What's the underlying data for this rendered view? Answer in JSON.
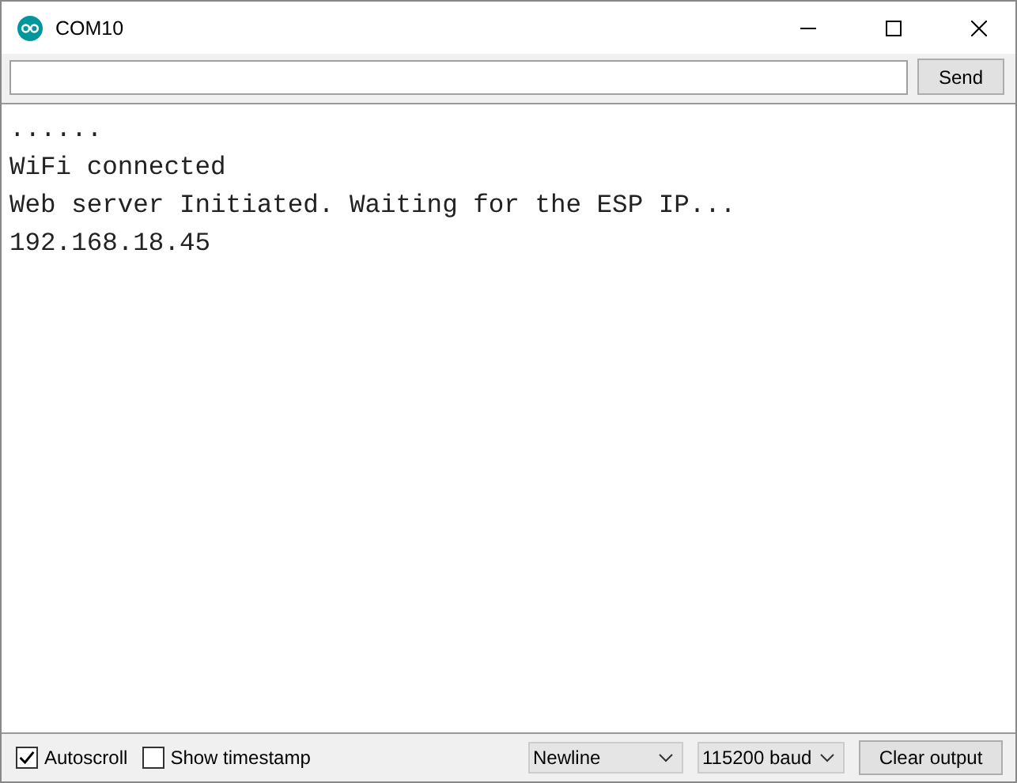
{
  "window": {
    "title": "COM10"
  },
  "send_button": "Send",
  "output_lines": [
    "......",
    "WiFi connected",
    "Web server Initiated. Waiting for the ESP IP...",
    "192.168.18.45"
  ],
  "autoscroll": {
    "label": "Autoscroll",
    "checked": true
  },
  "timestamp": {
    "label": "Show timestamp",
    "checked": false
  },
  "line_ending": "Newline",
  "baud": "115200 baud",
  "clear_button": "Clear output"
}
